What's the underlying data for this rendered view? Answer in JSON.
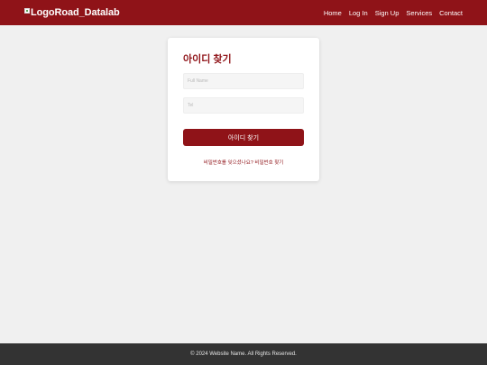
{
  "header": {
    "logo_alt": "LogoRoad_Datalab",
    "nav": {
      "home": "Home",
      "login": "Log In",
      "signup": "Sign Up",
      "services": "Services",
      "contact": "Contact"
    }
  },
  "card": {
    "title": "아이디 찾기",
    "full_name_placeholder": "Full Name",
    "tel_placeholder": "Tel",
    "submit_label": "아이디 찾기",
    "helper_question": "비밀번호를 잊으셨나요?",
    "helper_link": "비밀번호 찾기"
  },
  "footer": {
    "copyright": "© 2024 Website Name. All Rights Reserved."
  },
  "colors": {
    "brand": "#8f1318",
    "page_background": "#f0f0f0",
    "footer_background": "#333333"
  }
}
